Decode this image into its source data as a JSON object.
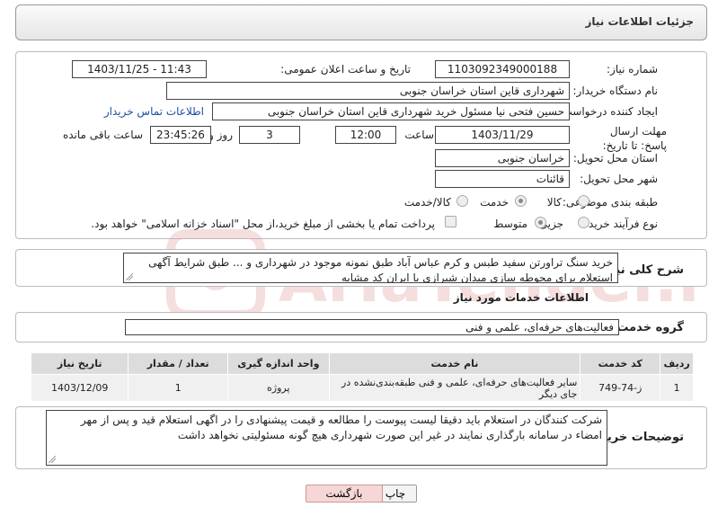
{
  "page_title": "جزئیات اطلاعات نیاز",
  "labels": {
    "need_number": "شماره نیاز:",
    "announce_datetime": "تاریخ و ساعت اعلان عمومی:",
    "buyer_org": "نام دستگاه خریدار:",
    "requester": "ایجاد کننده درخواست:",
    "contact_link": "اطلاعات تماس خریدار",
    "deadline": "مهلت ارسال پاسخ: تا تاریخ:",
    "time_word": "ساعت",
    "day_and": "روز و",
    "remaining": "ساعت باقی مانده",
    "province": "استان محل تحویل:",
    "city": "شهر محل تحویل:",
    "category": "طبقه بندی موضوعی:",
    "process_type": "نوع فرآیند خرید :",
    "general_desc": "شرح کلی نیاز:",
    "services_info": "اطلاعات خدمات مورد نیاز",
    "service_group": "گروه خدمت:",
    "buyer_notes": "توضیحات خریدار:"
  },
  "values": {
    "need_number": "1103092349000188",
    "announce_datetime": "1403/11/25 - 11:43",
    "buyer_org": "شهرداری قاین استان خراسان جنوبی",
    "requester": "حسین فتحی نیا مسئول خرید شهرداری قاین استان خراسان جنوبی",
    "deadline_date": "1403/11/29",
    "deadline_time": "12:00",
    "days": "3",
    "remaining_time": "23:45:26",
    "province": "خراسان جنوبی",
    "city": "قائنات",
    "general_desc": "خرید سنگ تراورتن سفید طبس و کرم عباس آباد طبق نمونه موجود در شهرداری و ... طبق شرایط آگهی استعلام برای محوطه سازی میدان شیرازی با ایران کد مشابه",
    "service_group": "فعالیت‌های حرفه‌ای، علمی و فنی",
    "buyer_notes": "شرکت کنندگان در استعلام باید دقیقا لیست پیوست را مطالعه و قیمت پیشنهادی را در اگهی استعلام قید و پس از مهر امضاء در سامانه بارگذاری نمایند در غیر این صورت شهرداری هیچ گونه مسئولیتی نخواهد داشت"
  },
  "category_options": {
    "goods": "کالا",
    "service": "خدمت",
    "goods_service": "کالا/خدمت",
    "selected": "service"
  },
  "process_options": {
    "partial": "جزیی",
    "medium": "متوسط",
    "selected": "medium",
    "treasury_note": "پرداخت تمام یا بخشی از مبلغ خرید،از محل \"اسناد خزانه اسلامی\" خواهد بود."
  },
  "table": {
    "headers": [
      "ردیف",
      "کد خدمت",
      "نام خدمت",
      "واحد اندازه گیری",
      "تعداد / مقدار",
      "تاریخ نیاز"
    ],
    "rows": [
      [
        "1",
        "ز-74-749",
        "سایر فعالیت‌های حرفه‌ای، علمی و فنی طبقه‌بندی‌نشده در جای دیگر",
        "پروژه",
        "1",
        "1403/12/09"
      ]
    ]
  },
  "buttons": {
    "print": "چاپ",
    "back": "بازگشت"
  },
  "colors": {
    "link": "#1a4fa0",
    "back_button_bg": "#f6d6d6",
    "watermark": "#e5a3a3"
  },
  "watermark": {
    "brand": "AriaTender.neT"
  }
}
